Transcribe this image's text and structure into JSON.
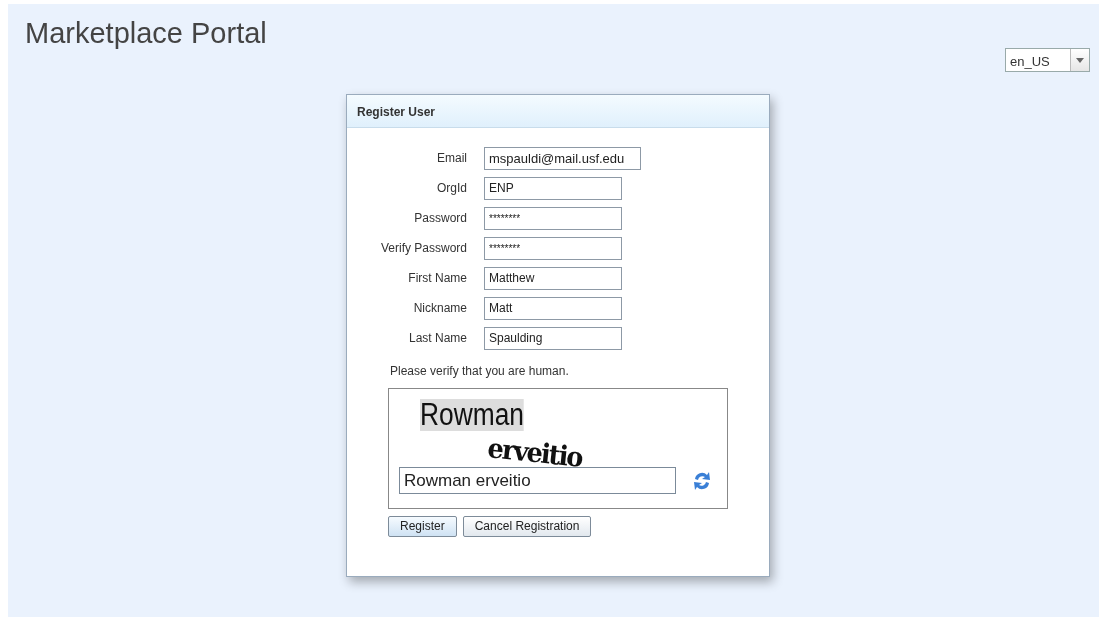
{
  "header": {
    "title": "Marketplace Portal"
  },
  "locale_select": {
    "value": "en_US"
  },
  "dialog": {
    "title": "Register User",
    "fields": [
      {
        "label": "Email",
        "value": "mspauldi@mail.usf.edu",
        "kind": "wide"
      },
      {
        "label": "OrgId",
        "value": "ENP",
        "kind": "text"
      },
      {
        "label": "Password",
        "value": "********",
        "kind": "password"
      },
      {
        "label": "Verify Password",
        "value": "********",
        "kind": "password"
      },
      {
        "label": "First Name",
        "value": "Matthew",
        "kind": "text"
      },
      {
        "label": "Nickname",
        "value": "Matt",
        "kind": "text"
      },
      {
        "label": "Last Name",
        "value": "Spaulding",
        "kind": "text"
      }
    ],
    "captcha_prompt": "Please verify that you are human.",
    "captcha": {
      "words": [
        "Rowman",
        "erveitio"
      ],
      "answer": "Rowman erveitio"
    },
    "buttons": [
      "Register",
      "Cancel Registration"
    ]
  }
}
